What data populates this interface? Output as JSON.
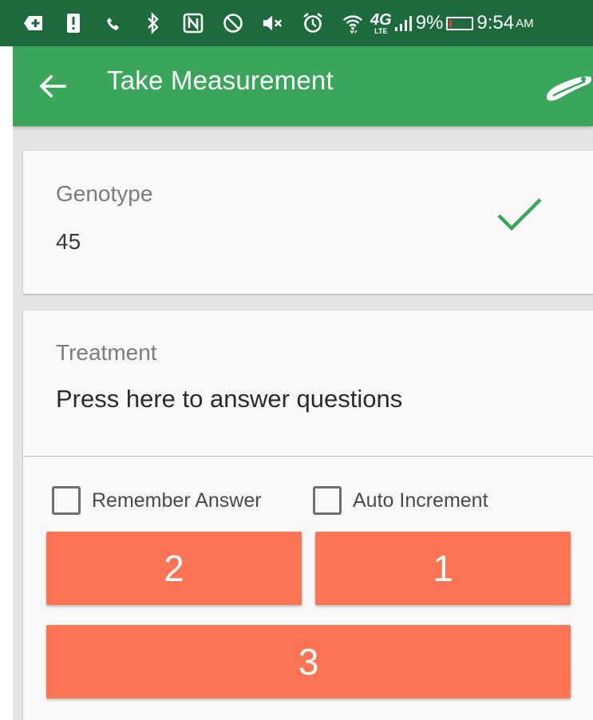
{
  "status_bar": {
    "icons": [
      "add-box-icon",
      "alert-icon",
      "missed-call-icon",
      "bluetooth-icon",
      "nfc-icon",
      "blocked-icon",
      "mute-icon",
      "alarm-icon",
      "wifi-icon",
      "lte-icon",
      "signal-icon"
    ],
    "lte_label": "4G",
    "battery_percent": "9%",
    "battery_level": 0.09,
    "battery_low_color": "#e53935",
    "time": "9:54",
    "ampm": "AM"
  },
  "app_bar": {
    "title": "Take Measurement",
    "color": "#3aa65a",
    "status_color": "#1d6b3c"
  },
  "genotype_card": {
    "label": "Genotype",
    "value": "45",
    "check_color": "#3aa65a"
  },
  "treatment_card": {
    "label": "Treatment",
    "prompt": "Press here to answer questions",
    "remember_answer": {
      "label": "Remember Answer",
      "checked": false
    },
    "auto_increment": {
      "label": "Auto Increment",
      "checked": false
    },
    "answer_buttons": [
      "2",
      "1",
      "3"
    ],
    "button_color": "#fc7453"
  }
}
